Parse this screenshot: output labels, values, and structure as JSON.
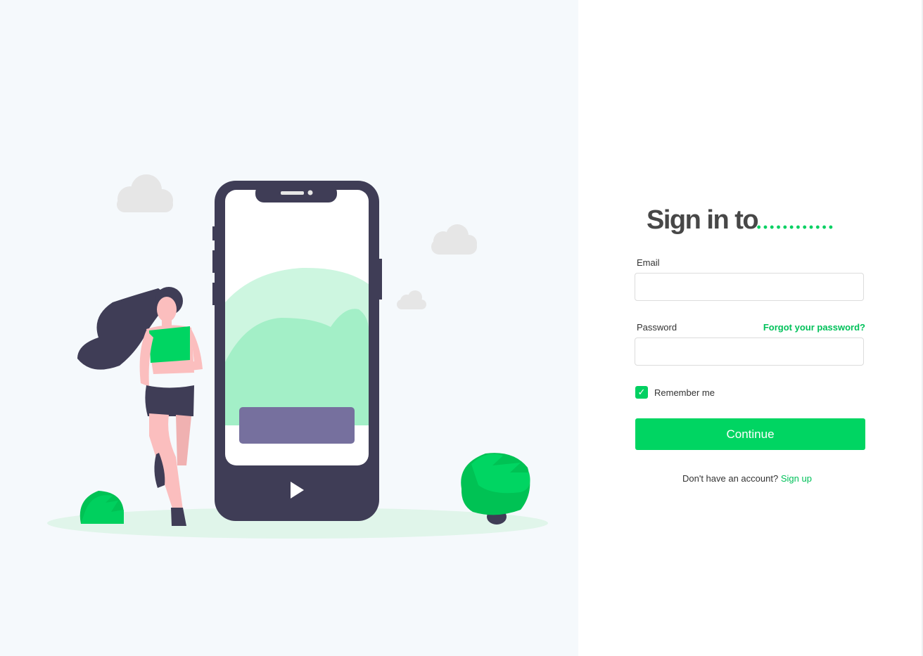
{
  "title": "Sign in to",
  "form": {
    "email_label": "Email",
    "email_value": "",
    "password_label": "Password",
    "password_value": "",
    "forgot_link": "Forgot your password?",
    "remember_label": "Remember me",
    "remember_checked": true,
    "continue_label": "Continue",
    "no_account_text": "Don't have an account?",
    "signup_link": "Sign up"
  },
  "colors": {
    "accent": "#00d562",
    "title": "#474747",
    "illustration_bg": "#f5f9fc"
  }
}
